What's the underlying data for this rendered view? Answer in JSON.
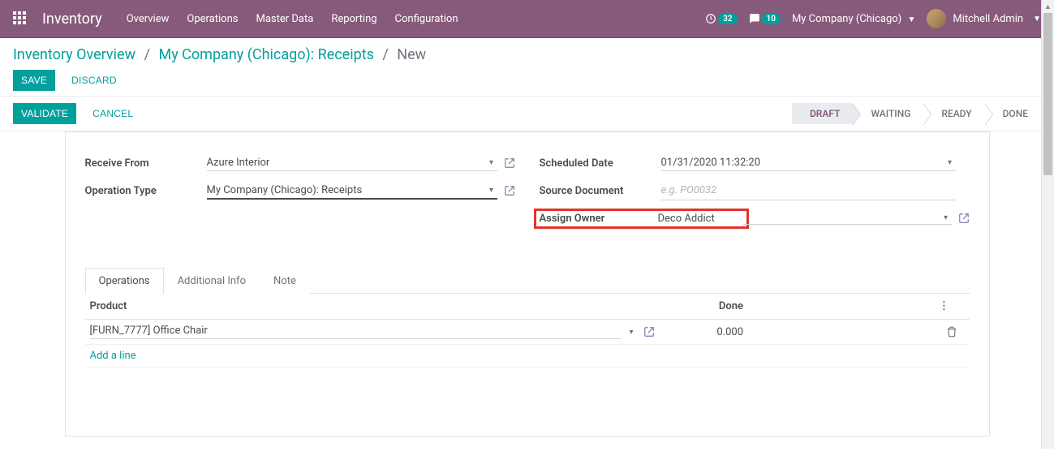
{
  "navbar": {
    "brand": "Inventory",
    "menu": [
      "Overview",
      "Operations",
      "Master Data",
      "Reporting",
      "Configuration"
    ],
    "activity_count": "32",
    "message_count": "10",
    "company": "My Company (Chicago)",
    "user_name": "Mitchell Admin"
  },
  "breadcrumb": {
    "items": [
      "Inventory Overview",
      "My Company (Chicago): Receipts"
    ],
    "current": "New"
  },
  "buttons": {
    "save": "SAVE",
    "discard": "DISCARD",
    "validate": "VALIDATE",
    "cancel": "CANCEL"
  },
  "status_steps": [
    "DRAFT",
    "WAITING",
    "READY",
    "DONE"
  ],
  "status_active": "DRAFT",
  "form": {
    "receive_from_label": "Receive From",
    "receive_from_value": "Azure Interior",
    "operation_type_label": "Operation Type",
    "operation_type_value": "My Company (Chicago): Receipts",
    "scheduled_date_label": "Scheduled Date",
    "scheduled_date_value": "01/31/2020 11:32:20",
    "source_doc_label": "Source Document",
    "source_doc_placeholder": "e.g. PO0032",
    "assign_owner_label": "Assign Owner",
    "assign_owner_value": "Deco Addict"
  },
  "tabs": [
    "Operations",
    "Additional Info",
    "Note"
  ],
  "active_tab": "Operations",
  "table": {
    "headers": {
      "product": "Product",
      "done": "Done"
    },
    "rows": [
      {
        "product": "[FURN_7777] Office Chair",
        "done": "0.000"
      }
    ],
    "add_line": "Add a line"
  }
}
